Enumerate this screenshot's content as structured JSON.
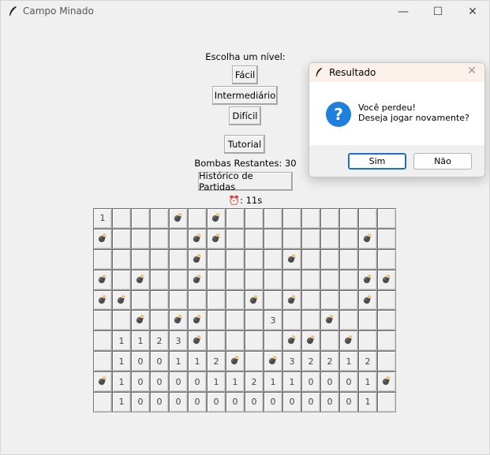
{
  "window": {
    "title": "Campo Minado",
    "min": "—",
    "max": "☐",
    "close": "✕"
  },
  "level": {
    "prompt": "Escolha um nível:",
    "easy": "Fácil",
    "medium": "Intermediário",
    "hard": "Difícil"
  },
  "tutorial": "Tutorial",
  "bombs_remaining": "Bombas Restantes: 30",
  "history": "Histórico de Partidas",
  "timer": {
    "icon": "⏰",
    "text": ": 11s"
  },
  "board": [
    [
      "1",
      "",
      "",
      "",
      "B",
      "",
      "B",
      "",
      "",
      "",
      "",
      "",
      "",
      "",
      "",
      ""
    ],
    [
      "B",
      "",
      "",
      "",
      "",
      "B",
      "B",
      "",
      "",
      "",
      "",
      "",
      "",
      "",
      "B",
      ""
    ],
    [
      "",
      "",
      "",
      "",
      "",
      "B",
      "",
      "",
      "",
      "",
      "B",
      "",
      "",
      "",
      "",
      ""
    ],
    [
      "B",
      "",
      "B",
      "",
      "",
      "B",
      "",
      "",
      "",
      "",
      "",
      "",
      "",
      "",
      "B",
      "B"
    ],
    [
      "B",
      "B",
      "",
      "",
      "",
      "",
      "",
      "",
      "B",
      "",
      "B",
      "",
      "",
      "",
      "B",
      ""
    ],
    [
      "",
      "",
      "B",
      "",
      "B",
      "B",
      "",
      "",
      "",
      "3",
      "",
      "",
      "B",
      "",
      "",
      ""
    ],
    [
      "",
      "1",
      "1",
      "2",
      "3",
      "B",
      "",
      "",
      "",
      "",
      "B",
      "B",
      "",
      "B",
      "",
      ""
    ],
    [
      "",
      "1",
      "0",
      "0",
      "1",
      "1",
      "2",
      "B",
      "",
      "B",
      "3",
      "2",
      "2",
      "1",
      "2",
      ""
    ],
    [
      "B",
      "1",
      "0",
      "0",
      "0",
      "0",
      "1",
      "1",
      "2",
      "1",
      "1",
      "0",
      "0",
      "0",
      "1",
      "B"
    ],
    [
      "",
      "1",
      "0",
      "0",
      "0",
      "0",
      "0",
      "0",
      "0",
      "0",
      "0",
      "0",
      "0",
      "0",
      "1",
      ""
    ]
  ],
  "dialog": {
    "title": "Resultado",
    "close": "✕",
    "line1": "Você perdeu!",
    "line2": "Deseja jogar novamente?",
    "yes": "Sim",
    "no": "Não",
    "icon": "?"
  }
}
